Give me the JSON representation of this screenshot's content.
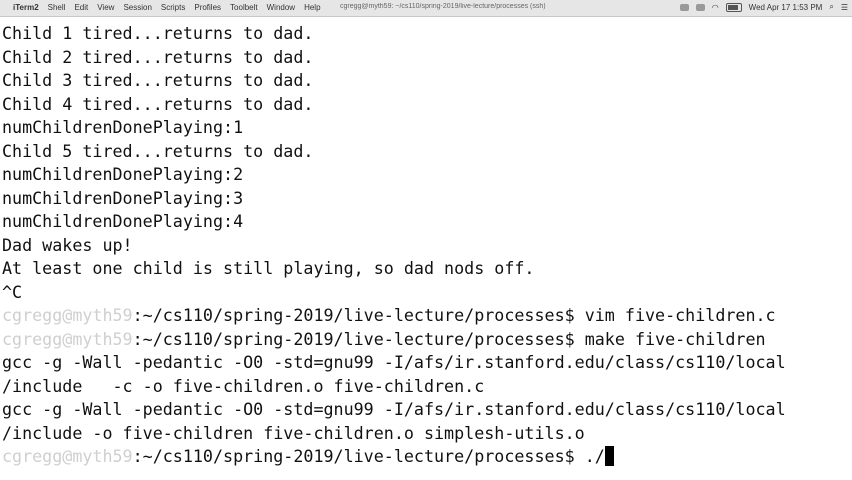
{
  "menubar": {
    "app": "iTerm2",
    "items": [
      "Shell",
      "Edit",
      "View",
      "Session",
      "Scripts",
      "Profiles",
      "Toolbelt",
      "Window",
      "Help"
    ],
    "window_title": "cgregg@myth59: ~/cs110/spring-2019/live-lecture/processes (ssh)",
    "clock": "Wed Apr 17 1:53 PM"
  },
  "terminal": {
    "output_lines": [
      "Child 1 tired...returns to dad.",
      "Child 2 tired...returns to dad.",
      "Child 3 tired...returns to dad.",
      "Child 4 tired...returns to dad.",
      "numChildrenDonePlaying:1",
      "Child 5 tired...returns to dad.",
      "numChildrenDonePlaying:2",
      "numChildrenDonePlaying:3",
      "numChildrenDonePlaying:4",
      "Dad wakes up!",
      "At least one child is still playing, so dad nods off.",
      "^C"
    ],
    "prompt_user": "cgregg@myth59",
    "prompt_path": ":~/cs110/spring-2019/live-lecture/processes$ ",
    "cmd1": "vim five-children.c",
    "cmd2": "make five-children",
    "gcc_lines": [
      "gcc -g -Wall -pedantic -O0 -std=gnu99 -I/afs/ir.stanford.edu/class/cs110/local",
      "/include   -c -o five-children.o five-children.c",
      "gcc -g -Wall -pedantic -O0 -std=gnu99 -I/afs/ir.stanford.edu/class/cs110/local",
      "/include -o five-children five-children.o simplesh-utils.o"
    ],
    "current_input": "./"
  }
}
